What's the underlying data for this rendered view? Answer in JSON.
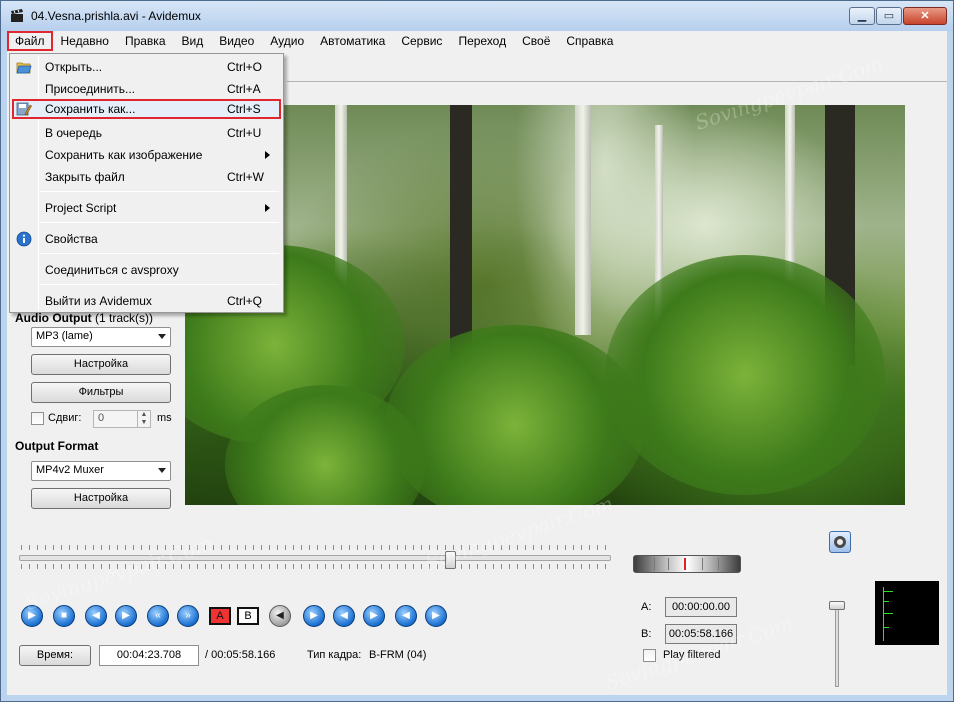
{
  "window": {
    "title": "04.Vesna.prishla.avi - Avidemux",
    "minimize": "▁",
    "maximize": "▭",
    "close": "✕"
  },
  "menubar": {
    "items": [
      "Файл",
      "Недавно",
      "Правка",
      "Вид",
      "Видео",
      "Аудио",
      "Автоматика",
      "Сервис",
      "Переход",
      "Своё",
      "Справка"
    ],
    "active_index": 0
  },
  "file_menu": {
    "items": [
      {
        "label": "Открыть...",
        "shortcut": "Ctrl+O",
        "icon": "open-folder-icon"
      },
      {
        "label": "Присоединить...",
        "shortcut": "Ctrl+A"
      },
      {
        "label": "Сохранить как...",
        "shortcut": "Ctrl+S",
        "icon": "save-icon",
        "highlighted": true
      },
      {
        "label": "В очередь",
        "shortcut": "Ctrl+U"
      },
      {
        "label": "Сохранить как изображение",
        "submenu": true
      },
      {
        "label": "Закрыть файл",
        "shortcut": "Ctrl+W"
      },
      {
        "label": "Project Script",
        "submenu": true
      },
      {
        "label": "Свойства",
        "icon": "info-icon"
      },
      {
        "label": "Соединиться с avsproxy"
      },
      {
        "label": "Выйти из Avidemux",
        "shortcut": "Ctrl+Q"
      }
    ]
  },
  "audio_output": {
    "title": "Audio Output",
    "tracks": "(1 track(s))",
    "codec": "MP3 (lame)",
    "settings_label": "Настройка",
    "filters_label": "Фильтры",
    "shift_label": "Сдвиг:",
    "shift_value": "0",
    "shift_unit": "ms"
  },
  "output_format": {
    "title": "Output Format",
    "muxer": "MP4v2 Muxer",
    "settings_label": "Настройка"
  },
  "playback": {
    "position_fraction": 0.73,
    "buttons": [
      "play",
      "stop",
      "prev-frame",
      "next-frame",
      "prev-keyframe",
      "next-keyframe",
      "set-marker-a",
      "set-marker-b",
      "prev-black",
      "goto-a",
      "goto-b",
      "next-black",
      "first-frame",
      "last-frame"
    ],
    "marker_a_label": "A",
    "marker_b_label": "B"
  },
  "time": {
    "button_label": "Время:",
    "current": "00:04:23.708",
    "total": "/ 00:05:58.166",
    "frame_type_label": "Тип кадра:",
    "frame_type_value": "B-FRM (04)"
  },
  "selection": {
    "a_label": "A:",
    "a_value": "00:00:00.00",
    "b_label": "B:",
    "b_value": "00:05:58.166",
    "play_filtered_label": "Play filtered"
  },
  "watermark_text": "Sovingpevpair.Com",
  "colors": {
    "highlight": "#e0262e",
    "accent": "#1a6fd0"
  }
}
